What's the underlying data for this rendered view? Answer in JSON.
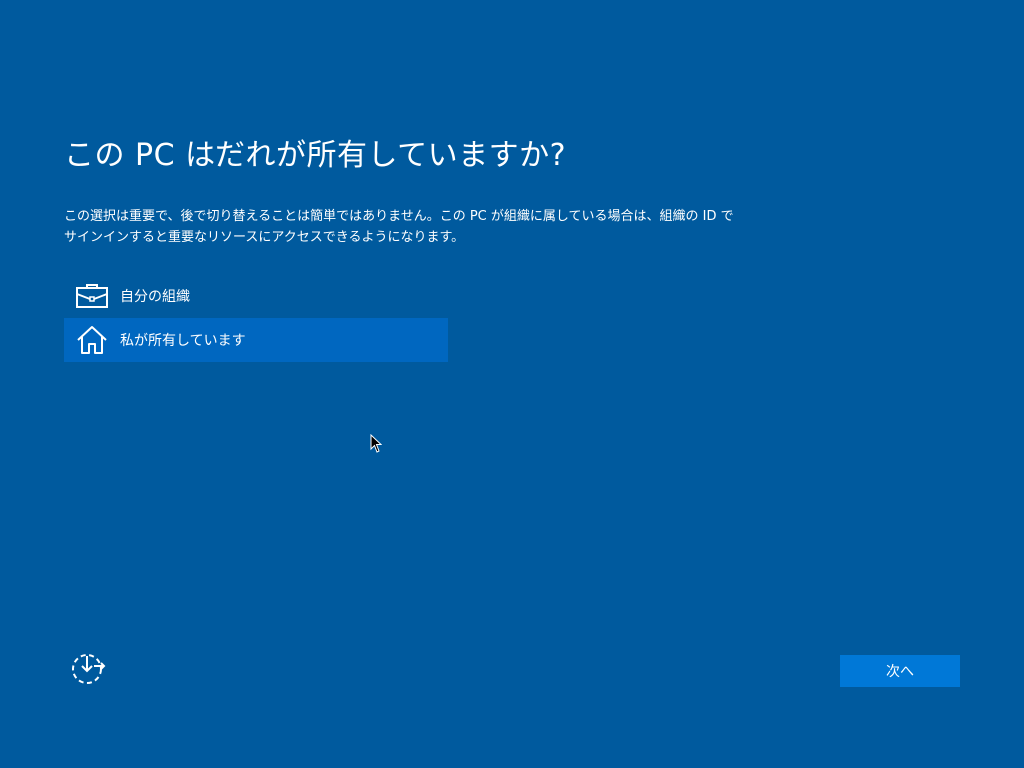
{
  "title": "この PC はだれが所有していますか?",
  "description": "この選択は重要で、後で切り替えることは簡単ではありません。この PC が組織に属している場合は、組織の ID でサインインすると重要なリソースにアクセスできるようになります。",
  "options": [
    {
      "label": "自分の組織",
      "icon": "briefcase-icon",
      "selected": false
    },
    {
      "label": "私が所有しています",
      "icon": "home-icon",
      "selected": true
    }
  ],
  "accessibility": {
    "icon": "ease-of-access-icon"
  },
  "next_button": {
    "label": "次へ"
  },
  "colors": {
    "background": "#005a9e",
    "selected_option": "#0067c0",
    "button": "#0078d7",
    "text": "#ffffff"
  }
}
